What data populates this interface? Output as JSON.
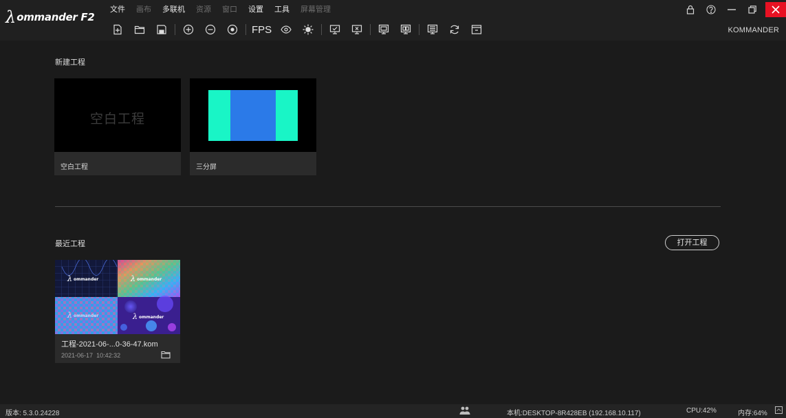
{
  "app": {
    "logo_symbol": "λ",
    "logo_text": "ommander F2",
    "user": "KOMMANDER"
  },
  "menu": [
    {
      "label": "文件",
      "enabled": true
    },
    {
      "label": "画布",
      "enabled": false
    },
    {
      "label": "多联机",
      "enabled": true
    },
    {
      "label": "资源",
      "enabled": false
    },
    {
      "label": "窗口",
      "enabled": false
    },
    {
      "label": "设置",
      "enabled": true
    },
    {
      "label": "工具",
      "enabled": true
    },
    {
      "label": "屏幕管理",
      "enabled": false
    }
  ],
  "toolbar": {
    "fps_label": "FPS",
    "icons": [
      "new-file-icon",
      "open-folder-icon",
      "save-icon",
      "zoom-in-icon",
      "zoom-out-icon",
      "target-icon",
      "eye-icon",
      "brightness-icon",
      "monitor-check-icon",
      "monitor-close-icon",
      "screen-grid-icon",
      "screen-split-icon",
      "screen-layout-icon",
      "refresh-icon",
      "window-icon"
    ]
  },
  "new_project": {
    "title": "新建工程",
    "cards": [
      {
        "thumb_text": "空白工程",
        "label": "空白工程"
      },
      {
        "label": "三分屏",
        "colors": [
          "#19f5c6",
          "#2b7ae8",
          "#19f5c6"
        ]
      }
    ]
  },
  "recent": {
    "title": "最近工程",
    "open_label": "打开工程",
    "items": [
      {
        "name": "工程-2021-06-...0-36-47.kom",
        "date": "2021-06-17",
        "time": "10:42:32"
      }
    ]
  },
  "status": {
    "version_label": "版本: 5.3.0.24228",
    "host": "本机:DESKTOP-8R428EB (192.168.10.117)",
    "cpu": "CPU:42%",
    "mem": "内存:64%"
  },
  "colors": {
    "background": "#1b1b1b",
    "topbar": "#202020",
    "card": "#2b2b2b",
    "close_button": "#e81123"
  }
}
